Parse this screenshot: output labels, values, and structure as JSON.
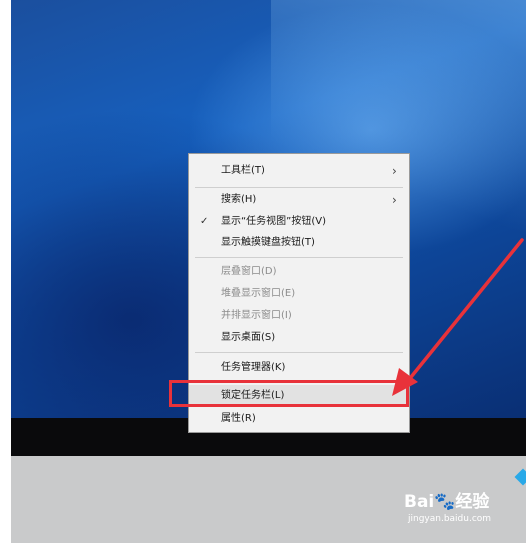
{
  "menu": {
    "items": [
      {
        "label": "工具栏(T)",
        "submenu": true,
        "checked": false,
        "disabled": false
      },
      {
        "label": "搜索(H)",
        "submenu": true,
        "checked": false,
        "disabled": false
      },
      {
        "label": "显示“任务视图”按钮(V)",
        "submenu": false,
        "checked": true,
        "disabled": false
      },
      {
        "label": "显示触摸键盘按钮(T)",
        "submenu": false,
        "checked": false,
        "disabled": false
      },
      {
        "label": "层叠窗口(D)",
        "submenu": false,
        "checked": false,
        "disabled": true
      },
      {
        "label": "堆叠显示窗口(E)",
        "submenu": false,
        "checked": false,
        "disabled": true
      },
      {
        "label": "并排显示窗口(I)",
        "submenu": false,
        "checked": false,
        "disabled": true
      },
      {
        "label": "显示桌面(S)",
        "submenu": false,
        "checked": false,
        "disabled": false
      },
      {
        "label": "任务管理器(K)",
        "submenu": false,
        "checked": false,
        "disabled": false
      },
      {
        "label": "锁定任务栏(L)",
        "submenu": false,
        "checked": false,
        "disabled": false,
        "highlighted": true
      },
      {
        "label": "属性(R)",
        "submenu": false,
        "checked": false,
        "disabled": false
      }
    ],
    "chevron": "›",
    "checkmark": "✓"
  },
  "annotation": {
    "highlight_color": "#e8323a",
    "arrow_color": "#e8323a"
  },
  "watermark": {
    "logo": "Bai🐾经验",
    "url": "jingyan.baidu.com"
  }
}
